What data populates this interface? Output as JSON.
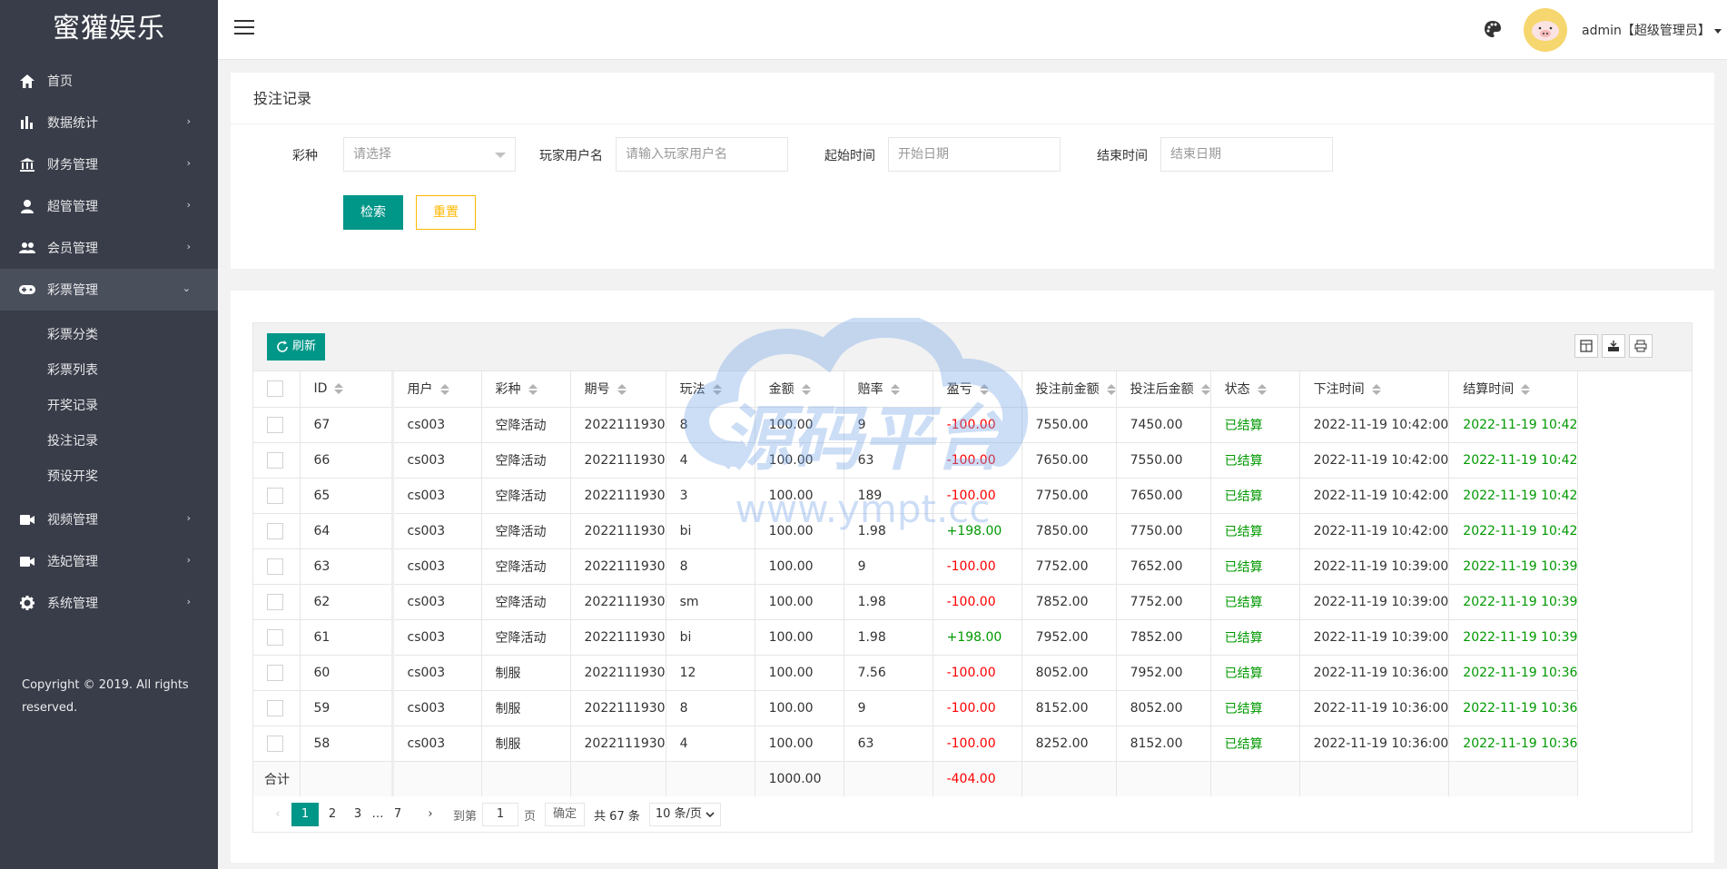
{
  "brand": "蜜獾娱乐",
  "sidebar": {
    "items": [
      {
        "label": "首页",
        "icon": "home-icon",
        "arrow": ""
      },
      {
        "label": "数据统计",
        "icon": "bar-chart-icon",
        "arrow": "›"
      },
      {
        "label": "财务管理",
        "icon": "bank-icon",
        "arrow": "›"
      },
      {
        "label": "超管管理",
        "icon": "user-icon",
        "arrow": "›"
      },
      {
        "label": "会员管理",
        "icon": "users-icon",
        "arrow": "›"
      },
      {
        "label": "彩票管理",
        "icon": "gamepad-icon",
        "arrow": "⌄"
      },
      {
        "label": "视频管理",
        "icon": "video-icon",
        "arrow": "›"
      },
      {
        "label": "选妃管理",
        "icon": "camera-icon",
        "arrow": "›"
      },
      {
        "label": "系统管理",
        "icon": "gear-icon",
        "arrow": "›"
      }
    ],
    "sub_items": [
      "彩票分类",
      "彩票列表",
      "开奖记录",
      "投注记录",
      "预设开奖"
    ],
    "copyright": "Copyright © 2019. All rights reserved."
  },
  "header": {
    "admin": "admin【超级管理员】"
  },
  "search": {
    "title": "投注记录",
    "lottery_label": "彩种",
    "lottery_placeholder": "请选择",
    "player_label": "玩家用户名",
    "player_placeholder": "请输入玩家用户名",
    "start_label": "起始时间",
    "start_placeholder": "开始日期",
    "end_label": "结束时间",
    "end_placeholder": "结束日期",
    "search_btn": "检索",
    "reset_btn": "重置"
  },
  "table": {
    "refresh": "刷新",
    "columns": [
      "ID",
      "用户",
      "彩种",
      "期号",
      "玩法",
      "金额",
      "赔率",
      "盈亏",
      "投注前金额",
      "投注后金额",
      "状态",
      "下注时间",
      "结算时间"
    ],
    "rows": [
      [
        "67",
        "cs003",
        "空降活动",
        "2022111930",
        "8",
        "100.00",
        "9",
        "-100.00",
        "7550.00",
        "7450.00",
        "已结算",
        "2022-11-19 10:42:00",
        "2022-11-19 10:42"
      ],
      [
        "66",
        "cs003",
        "空降活动",
        "2022111930",
        "4",
        "100.00",
        "63",
        "-100.00",
        "7650.00",
        "7550.00",
        "已结算",
        "2022-11-19 10:42:00",
        "2022-11-19 10:42"
      ],
      [
        "65",
        "cs003",
        "空降活动",
        "2022111930",
        "3",
        "100.00",
        "189",
        "-100.00",
        "7750.00",
        "7650.00",
        "已结算",
        "2022-11-19 10:42:00",
        "2022-11-19 10:42"
      ],
      [
        "64",
        "cs003",
        "空降活动",
        "2022111930",
        "bi",
        "100.00",
        "1.98",
        "+198.00",
        "7850.00",
        "7750.00",
        "已结算",
        "2022-11-19 10:42:00",
        "2022-11-19 10:42"
      ],
      [
        "63",
        "cs003",
        "空降活动",
        "2022111930",
        "8",
        "100.00",
        "9",
        "-100.00",
        "7752.00",
        "7652.00",
        "已结算",
        "2022-11-19 10:39:00",
        "2022-11-19 10:39"
      ],
      [
        "62",
        "cs003",
        "空降活动",
        "2022111930",
        "sm",
        "100.00",
        "1.98",
        "-100.00",
        "7852.00",
        "7752.00",
        "已结算",
        "2022-11-19 10:39:00",
        "2022-11-19 10:39"
      ],
      [
        "61",
        "cs003",
        "空降活动",
        "2022111930",
        "bi",
        "100.00",
        "1.98",
        "+198.00",
        "7952.00",
        "7852.00",
        "已结算",
        "2022-11-19 10:39:00",
        "2022-11-19 10:39"
      ],
      [
        "60",
        "cs003",
        "制服",
        "2022111930",
        "12",
        "100.00",
        "7.56",
        "-100.00",
        "8052.00",
        "7952.00",
        "已结算",
        "2022-11-19 10:36:00",
        "2022-11-19 10:36"
      ],
      [
        "59",
        "cs003",
        "制服",
        "2022111930",
        "8",
        "100.00",
        "9",
        "-100.00",
        "8152.00",
        "8052.00",
        "已结算",
        "2022-11-19 10:36:00",
        "2022-11-19 10:36"
      ],
      [
        "58",
        "cs003",
        "制服",
        "2022111930",
        "4",
        "100.00",
        "63",
        "-100.00",
        "8252.00",
        "8152.00",
        "已结算",
        "2022-11-19 10:36:00",
        "2022-11-19 10:36"
      ]
    ],
    "total_label": "合计",
    "total_amount": "1000.00",
    "total_profit": "-404.00"
  },
  "pager": {
    "prev": "‹",
    "pages": [
      "1",
      "2",
      "3"
    ],
    "ellipsis": "…",
    "last": "7",
    "next": "›",
    "goto_label": "到第",
    "goto_value": "1",
    "page_unit": "页",
    "confirm": "确定",
    "total": "共 67 条",
    "size": "10 条/页"
  },
  "watermark": {
    "main": "源码平台",
    "url": "www.ympt.cc"
  },
  "colors": {
    "sidebar_bg": "#393d49",
    "primary": "#009688",
    "warm": "#ffb800",
    "loss": "#ff0000",
    "gain": "#009900"
  }
}
